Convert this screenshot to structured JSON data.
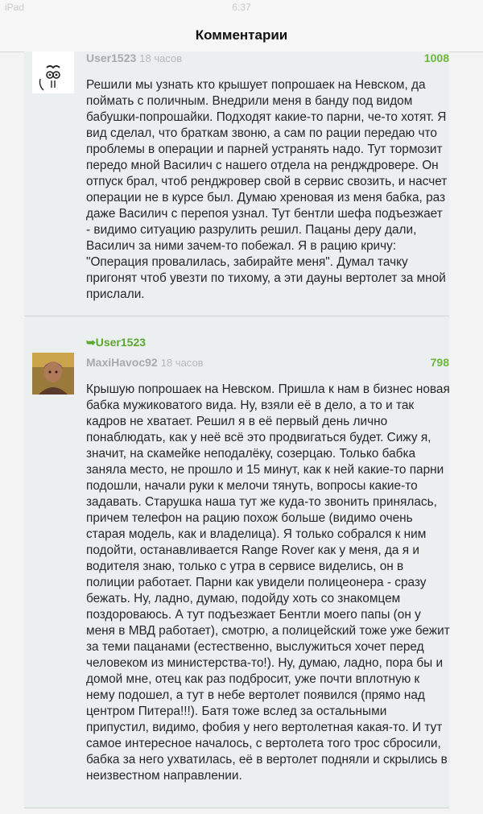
{
  "status_bar": {
    "carrier": "iPad",
    "time": "6:37"
  },
  "nav": {
    "title": "Комментарии"
  },
  "comments": [
    {
      "user": "User1523",
      "time": "18 часов",
      "score": "1008",
      "text": "Решили мы узнать кто крышует попрошаек на Невском, да поймать с поличным. Внедрили меня в банду под видом бабушки-попрошайки. Подходят какие-то парни, че-то хотят. Я вид сделал, что браткам звоню, а сам по рации передаю что проблемы в операции и парней устранять надо. Тут тормозит передо мной Василич с нашего отдела на рендждровере. Он отпуск брал, чтоб ренджровер свой в сервис свозить, и насчет операции не в курсе был. Думаю хреновая из меня бабка, раз даже Василич с перепоя узнал. Тут бентли шефа подъезжает - видимо ситуацию разрулить решил. Пацаны деру дали, Василич за ними зачем-то побежал. Я в рацию кричу: \"Операция провалилась, забирайте меня\". Думал тачку пригонят чтоб увезти по тихому, а эти дауны вертолет за мной прислали."
    },
    {
      "reply_to": "User1523",
      "user": "MaxiHavoc92",
      "time": "18 часов",
      "score": "798",
      "text": "Крышую попрошаек на Невском. Пришла к нам в бизнес новая бабка мужиковатого вида. Ну, взяли её в дело, а то и так кадров не хватает. Решил я в её первый день лично понаблюдать, как у неё всё это продвигаться будет. Сижу я, значит, на скамейке неподалёку, созерцаю. Только бабка заняла место, не прошло и 15 минут, как к ней какие-то парни подошли, начали руки к мелочи тянуть, вопросы какие-то задавать. Старушка наша тут же куда-то звонить принялась, причем телефон на рацию похож больше (видимо очень старая модель, как и владелица). Я только собрался к ним подойти, останавливается Range Rover как у меня, да я и водителя знаю, только с утра в сервисе виделись, он в полиции работает. Парни как увидели полицеонера - сразу бежать. Ну, ладно, думаю, подойду хоть со знакомцем поздороваюсь. А тут подъезжает Бентли моего папы (он у меня в МВД работает), смотрю, а полицейский тоже уже бежит за теми пацанами (естественно, выслужиться хочет перед человеком из министерства-то!). Ну, думаю, ладно, пора бы и домой мне, отец как раз подбросит, уже почти вплотную к нему подошел, а тут в небе вертолет появился (прямо над центром Питера!!!). Батя тоже вслед за остальными припустил, видимо, фобия у него вертолетная какая-то. И тут самое интересное началось, с вертолета того трос сбросили, бабка за него ухватилась, её в вертолет подняли и скрылись в неизвестном направлении."
    }
  ],
  "colors": {
    "score": "#6cb63e",
    "reply": "#58a82c",
    "username": "#a9a9a9",
    "card": "#eceff0"
  }
}
